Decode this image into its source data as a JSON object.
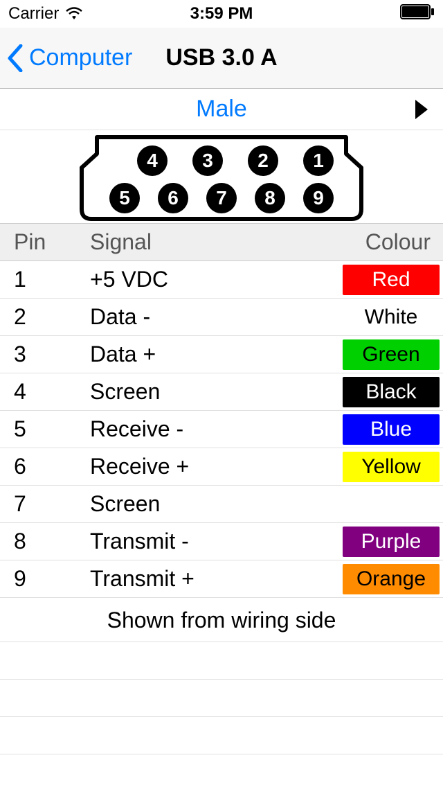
{
  "status": {
    "carrier": "Carrier",
    "time": "3:59 PM"
  },
  "nav": {
    "back_label": "Computer",
    "title": "USB 3.0 A"
  },
  "gender": {
    "label": "Male"
  },
  "connector": {
    "top_pins": [
      "4",
      "3",
      "2",
      "1"
    ],
    "bottom_pins": [
      "5",
      "6",
      "7",
      "8",
      "9"
    ]
  },
  "table": {
    "headers": {
      "pin": "Pin",
      "signal": "Signal",
      "colour": "Colour"
    },
    "rows": [
      {
        "pin": "1",
        "signal": "+5 VDC",
        "colour": "Red",
        "bg": "#ff0000",
        "fg": "#ffffff"
      },
      {
        "pin": "2",
        "signal": "Data -",
        "colour": "White",
        "bg": "#ffffff",
        "fg": "#000000"
      },
      {
        "pin": "3",
        "signal": "Data +",
        "colour": "Green",
        "bg": "#00d000",
        "fg": "#000000"
      },
      {
        "pin": "4",
        "signal": "Screen",
        "colour": "Black",
        "bg": "#000000",
        "fg": "#ffffff"
      },
      {
        "pin": "5",
        "signal": "Receive -",
        "colour": "Blue",
        "bg": "#0000ff",
        "fg": "#ffffff"
      },
      {
        "pin": "6",
        "signal": "Receive +",
        "colour": "Yellow",
        "bg": "#ffff00",
        "fg": "#000000"
      },
      {
        "pin": "7",
        "signal": "Screen",
        "colour": "",
        "bg": "",
        "fg": ""
      },
      {
        "pin": "8",
        "signal": "Transmit -",
        "colour": "Purple",
        "bg": "#800080",
        "fg": "#ffffff"
      },
      {
        "pin": "9",
        "signal": "Transmit +",
        "colour": "Orange",
        "bg": "#ff8c00",
        "fg": "#000000"
      }
    ]
  },
  "footer": {
    "note": "Shown from wiring side"
  }
}
